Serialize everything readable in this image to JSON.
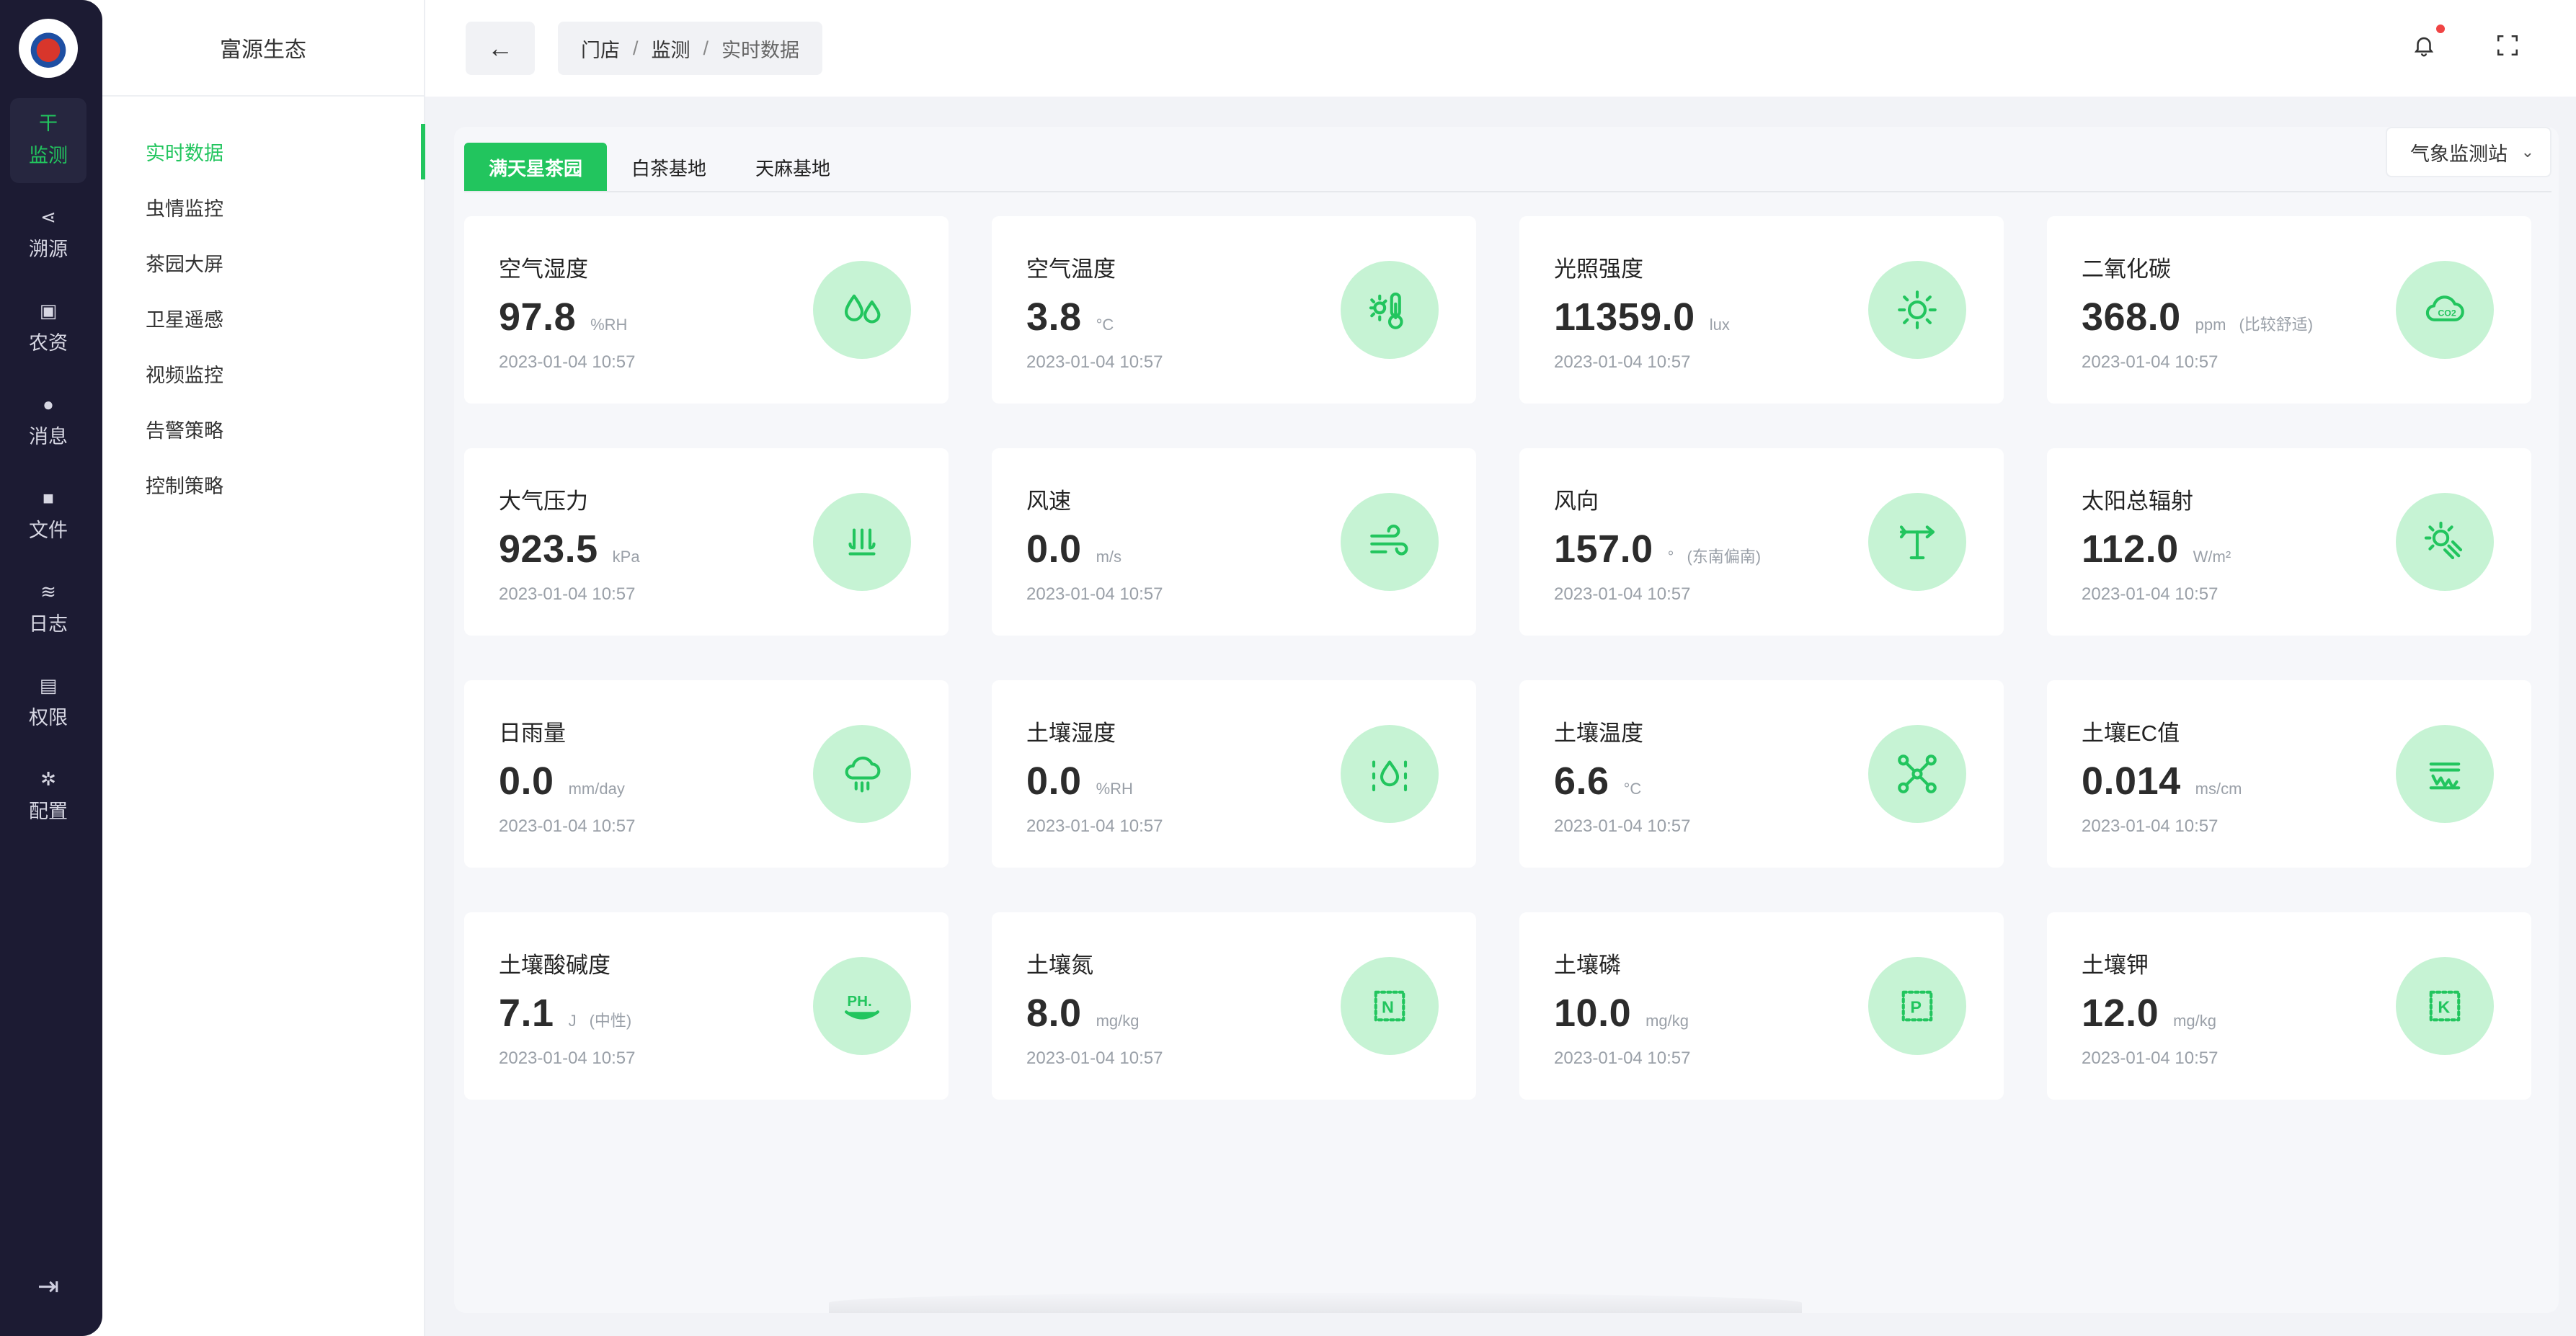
{
  "rail": {
    "items": [
      {
        "label": "监测",
        "icon": "filter-icon",
        "glyph": "⼲",
        "active": true
      },
      {
        "label": "溯源",
        "icon": "share-icon",
        "glyph": "⋖",
        "active": false
      },
      {
        "label": "农资",
        "icon": "box-icon",
        "glyph": "▣",
        "active": false
      },
      {
        "label": "消息",
        "icon": "chat-icon",
        "glyph": "●",
        "active": false
      },
      {
        "label": "文件",
        "icon": "folder-icon",
        "glyph": "■",
        "active": false
      },
      {
        "label": "日志",
        "icon": "database-icon",
        "glyph": "≋",
        "active": false
      },
      {
        "label": "权限",
        "icon": "id-card-icon",
        "glyph": "▤",
        "active": false
      },
      {
        "label": "配置",
        "icon": "gears-icon",
        "glyph": "✲",
        "active": false
      }
    ]
  },
  "menu": {
    "brand": "富源生态",
    "items": [
      {
        "label": "实时数据",
        "active": true
      },
      {
        "label": "虫情监控",
        "active": false
      },
      {
        "label": "茶园大屏",
        "active": false
      },
      {
        "label": "卫星遥感",
        "active": false
      },
      {
        "label": "视频监控",
        "active": false
      },
      {
        "label": "告警策略",
        "active": false
      },
      {
        "label": "控制策略",
        "active": false
      }
    ]
  },
  "breadcrumb": {
    "store": "门店",
    "monitor": "监测",
    "current": "实时数据",
    "sep": "/"
  },
  "tabs": [
    {
      "label": "满天星茶园",
      "active": true
    },
    {
      "label": "白茶基地",
      "active": false
    },
    {
      "label": "天麻基地",
      "active": false
    }
  ],
  "station": "气象监测站",
  "accent": "#22c55e",
  "cards": [
    {
      "label": "空气湿度",
      "value": "97.8",
      "unit": "%RH",
      "note": "",
      "time": "2023-01-04 10:57",
      "icon": "drops-icon"
    },
    {
      "label": "空气温度",
      "value": "3.8",
      "unit": "°C",
      "note": "",
      "time": "2023-01-04 10:57",
      "icon": "thermometer-sun-icon"
    },
    {
      "label": "光照强度",
      "value": "11359.0",
      "unit": "lux",
      "note": "",
      "time": "2023-01-04 10:57",
      "icon": "sun-icon"
    },
    {
      "label": "二氧化碳",
      "value": "368.0",
      "unit": "ppm",
      "note": "(比较舒适)",
      "time": "2023-01-04 10:57",
      "icon": "co2-cloud-icon"
    },
    {
      "label": "大气压力",
      "value": "923.5",
      "unit": "kPa",
      "note": "",
      "time": "2023-01-04 10:57",
      "icon": "pressure-icon"
    },
    {
      "label": "风速",
      "value": "0.0",
      "unit": "m/s",
      "note": "",
      "time": "2023-01-04 10:57",
      "icon": "wind-icon"
    },
    {
      "label": "风向",
      "value": "157.0",
      "unit": "°",
      "note": "(东南偏南)",
      "time": "2023-01-04 10:57",
      "icon": "wind-vane-icon"
    },
    {
      "label": "太阳总辐射",
      "value": "112.0",
      "unit": "W/m²",
      "note": "",
      "time": "2023-01-04 10:57",
      "icon": "solar-radiation-icon"
    },
    {
      "label": "日雨量",
      "value": "0.0",
      "unit": "mm/day",
      "note": "",
      "time": "2023-01-04 10:57",
      "icon": "rain-cloud-icon"
    },
    {
      "label": "土壤湿度",
      "value": "0.0",
      "unit": "%RH",
      "note": "",
      "time": "2023-01-04 10:57",
      "icon": "soil-moisture-icon"
    },
    {
      "label": "土壤温度",
      "value": "6.6",
      "unit": "°C",
      "note": "",
      "time": "2023-01-04 10:57",
      "icon": "network-icon"
    },
    {
      "label": "土壤EC值",
      "value": "0.014",
      "unit": "ms/cm",
      "note": "",
      "time": "2023-01-04 10:57",
      "icon": "soil-ec-icon"
    },
    {
      "label": "土壤酸碱度",
      "value": "7.1",
      "unit": "J",
      "note": "(中性)",
      "time": "2023-01-04 10:57",
      "icon": "ph-icon"
    },
    {
      "label": "土壤氮",
      "value": "8.0",
      "unit": "mg/kg",
      "note": "",
      "time": "2023-01-04 10:57",
      "icon": "nitrogen-icon"
    },
    {
      "label": "土壤磷",
      "value": "10.0",
      "unit": "mg/kg",
      "note": "",
      "time": "2023-01-04 10:57",
      "icon": "phosphorus-icon"
    },
    {
      "label": "土壤钾",
      "value": "12.0",
      "unit": "mg/kg",
      "note": "",
      "time": "2023-01-04 10:57",
      "icon": "potassium-icon"
    }
  ]
}
